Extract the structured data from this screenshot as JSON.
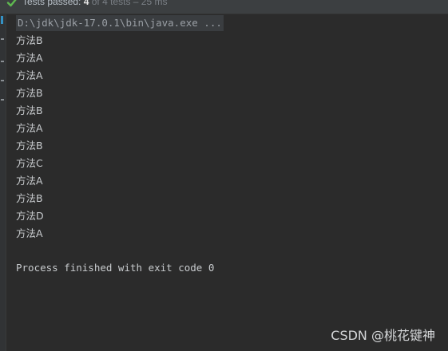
{
  "status_bar": {
    "icon": "check-icon",
    "passed_label": "Tests passed:",
    "passed_count": "4",
    "summary": "of 4 tests – 25 ms",
    "accent_color": "#5fb950"
  },
  "console": {
    "command": "D:\\jdk\\jdk-17.0.1\\bin\\java.exe ...",
    "output_lines": [
      "方法B",
      "方法A",
      "方法A",
      "方法B",
      "方法B",
      "方法A",
      "方法B",
      "方法C",
      "方法A",
      "方法B",
      "方法D",
      "方法A"
    ],
    "finish_message": "Process finished with exit code 0"
  },
  "watermark": "CSDN @桃花键神"
}
